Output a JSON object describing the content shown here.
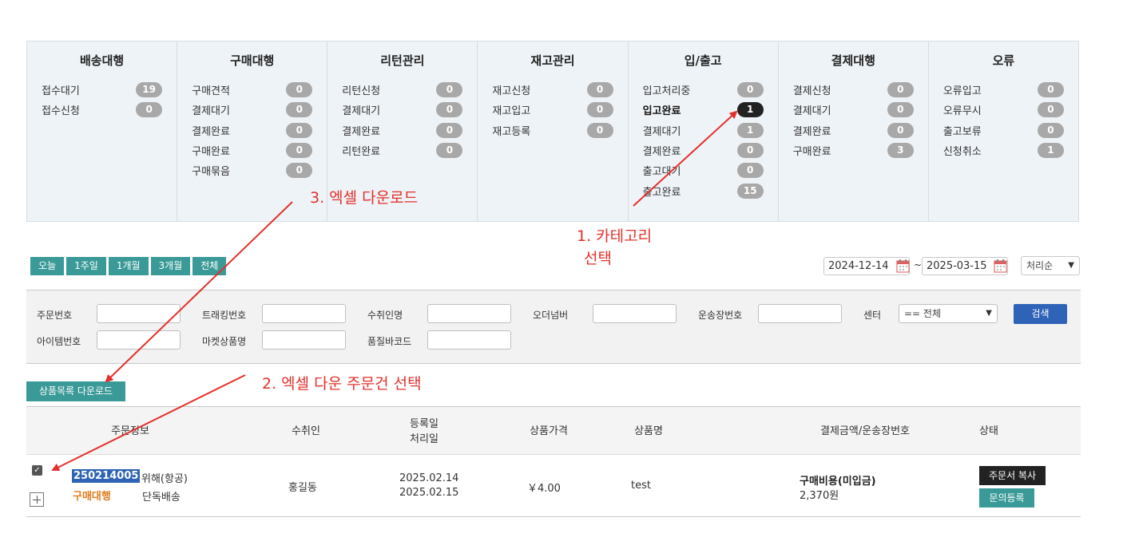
{
  "status_panel": {
    "columns": [
      {
        "title": "배송대행",
        "items": [
          {
            "label": "접수대기",
            "count": "19"
          },
          {
            "label": "접수신청",
            "count": "0"
          }
        ]
      },
      {
        "title": "구매대행",
        "items": [
          {
            "label": "구매견적",
            "count": "0"
          },
          {
            "label": "결제대기",
            "count": "0"
          },
          {
            "label": "결제완료",
            "count": "0"
          },
          {
            "label": "구매완료",
            "count": "0"
          },
          {
            "label": "구매묶음",
            "count": "0"
          }
        ]
      },
      {
        "title": "리턴관리",
        "items": [
          {
            "label": "리턴신청",
            "count": "0"
          },
          {
            "label": "결제대기",
            "count": "0"
          },
          {
            "label": "결제완료",
            "count": "0"
          },
          {
            "label": "리턴완료",
            "count": "0"
          }
        ]
      },
      {
        "title": "재고관리",
        "items": [
          {
            "label": "재고신청",
            "count": "0"
          },
          {
            "label": "재고입고",
            "count": "0"
          },
          {
            "label": "재고등록",
            "count": "0"
          }
        ]
      },
      {
        "title": "입/출고",
        "items": [
          {
            "label": "입고처리중",
            "count": "0"
          },
          {
            "label": "입고완료",
            "count": "1",
            "selected": true
          },
          {
            "label": "결제대기",
            "count": "1"
          },
          {
            "label": "결제완료",
            "count": "0"
          },
          {
            "label": "출고대기",
            "count": "0"
          },
          {
            "label": "출고완료",
            "count": "15"
          }
        ]
      },
      {
        "title": "결제대행",
        "items": [
          {
            "label": "결제신청",
            "count": "0"
          },
          {
            "label": "결제대기",
            "count": "0"
          },
          {
            "label": "결제완료",
            "count": "0"
          },
          {
            "label": "구매완료",
            "count": "3"
          }
        ]
      },
      {
        "title": "오류",
        "items": [
          {
            "label": "오류입고",
            "count": "0"
          },
          {
            "label": "오류무시",
            "count": "0"
          },
          {
            "label": "출고보류",
            "count": "0"
          },
          {
            "label": "신청취소",
            "count": "1"
          }
        ]
      }
    ]
  },
  "period_buttons": [
    "오늘",
    "1주일",
    "1개월",
    "3개월",
    "전체"
  ],
  "date_range": {
    "start": "2024-12-14",
    "separator": "~",
    "end": "2025-03-15"
  },
  "sort_select": {
    "value": "처리순"
  },
  "search": {
    "labels": {
      "order_no": "주문번호",
      "tracking_no": "트래킹번호",
      "recipient": "수취인명",
      "order_number": "오더넘버",
      "waybill_no": "운송장번호",
      "center": "센터",
      "item_no": "아이템번호",
      "market_product": "마켓상품명",
      "quality_barcode": "품질바코드"
    },
    "center_value": "== 전체",
    "search_button": "검색"
  },
  "download_button": "상품목록 다운로드",
  "table": {
    "headers": {
      "order_info": "주문정보",
      "recipient": "수취인",
      "registered": "등록일",
      "processed": "처리일",
      "price": "상품가격",
      "product": "상품명",
      "payment": "결제금액/운송장번호",
      "status": "상태"
    },
    "row": {
      "order_no": "250214005",
      "shipping_method": "위해(항공)",
      "order_type": "구매대행",
      "delivery_type": "단독배송",
      "recipient": "홍길동",
      "registered_date": "2025.02.14",
      "processed_date": "2025.02.15",
      "price": "￥4.00",
      "product": "test",
      "payment_label": "구매비용(미입금)",
      "payment_amount": "2,370원",
      "copy_button": "주문서 복사",
      "inquiry_button": "문의등록"
    }
  },
  "annotations": {
    "step1_line1": "1. 카테고리",
    "step1_line2": "선택",
    "step2": "2. 엑셀 다운 주문건 선택",
    "step3": "3. 엑셀 다운로드",
    "color": "#e4302b"
  },
  "colors": {
    "teal": "#3a9a97",
    "blue": "#2f63b8",
    "orange": "#e07c1c",
    "panel_bg": "#eef3f7"
  }
}
